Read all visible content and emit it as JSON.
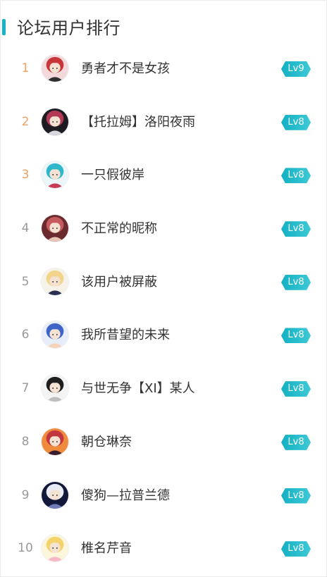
{
  "panel": {
    "title": "论坛用户排行",
    "accent_color": "#17b3c7"
  },
  "users": [
    {
      "rank": "1",
      "name": "勇者才不是女孩",
      "level": "Lv9",
      "avatar": "anime-girls-group-avatar",
      "colors": [
        "#f3d9d9",
        "#c9363a",
        "#2f2f2f"
      ]
    },
    {
      "rank": "2",
      "name": "【托拉姆】洛阳夜雨",
      "level": "Lv8",
      "avatar": "dark-character-avatar",
      "colors": [
        "#1c1c22",
        "#b23a54",
        "#d8d8e0"
      ]
    },
    {
      "rank": "3",
      "name": "一只假彼岸",
      "level": "Lv8",
      "avatar": "cyan-hair-girl-avatar",
      "colors": [
        "#eaf6f9",
        "#2fb7c9",
        "#c63b55"
      ]
    },
    {
      "rank": "4",
      "name": "不正常的昵称",
      "level": "Lv8",
      "avatar": "red-hair-girl-avatar",
      "colors": [
        "#6b2a2e",
        "#c65b5f",
        "#e8c4b8"
      ]
    },
    {
      "rank": "5",
      "name": "该用户被屏蔽",
      "level": "Lv8",
      "avatar": "blonde-girl-avatar",
      "colors": [
        "#f7f2e8",
        "#f2d48a",
        "#2a2f52"
      ]
    },
    {
      "rank": "6",
      "name": "我所昔望的未来",
      "level": "Lv8",
      "avatar": "blue-hair-girl-avatar",
      "colors": [
        "#e8eef9",
        "#3e64c8",
        "#f5d2b8"
      ]
    },
    {
      "rank": "7",
      "name": "与世无争【XI】某人",
      "level": "Lv8",
      "avatar": "sketch-girl-avatar",
      "colors": [
        "#f4f4f4",
        "#1e1e1e",
        "#bdbdbd"
      ]
    },
    {
      "rank": "8",
      "name": "朝仓琳奈",
      "level": "Lv8",
      "avatar": "sunset-avatar",
      "colors": [
        "#f08a3c",
        "#c2373f",
        "#3a1d2d"
      ]
    },
    {
      "rank": "9",
      "name": "傻狗—拉普兰德",
      "level": "Lv8",
      "avatar": "white-wolf-girl-avatar",
      "colors": [
        "#12183a",
        "#e8ecf4",
        "#6f7bb8"
      ]
    },
    {
      "rank": "10",
      "name": "椎名芹音",
      "level": "Lv8",
      "avatar": "yellow-flower-avatar",
      "colors": [
        "#fbf6dc",
        "#f3d36a",
        "#f6b7c6"
      ]
    }
  ]
}
